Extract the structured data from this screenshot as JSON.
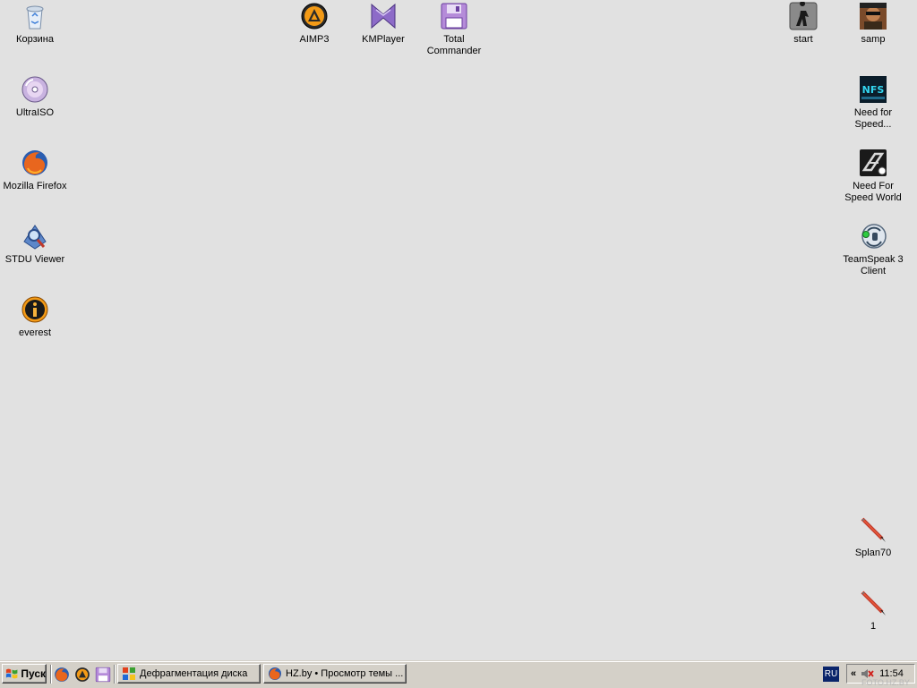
{
  "desktop": {
    "icons": {
      "recycle_bin": "Корзина",
      "ultraiso": "UltraISO",
      "firefox": "Mozilla Firefox",
      "stdu": "STDU Viewer",
      "everest": "everest",
      "aimp": "AIMP3",
      "kmplayer": "KMPlayer",
      "total_commander": "Total Commander",
      "start": "start",
      "samp": "samp",
      "nfs": "Need for Speed...",
      "nfs_world": "Need For Speed World",
      "teamspeak": "TeamSpeak 3 Client",
      "splan": "Splan70",
      "one": "1"
    }
  },
  "taskbar": {
    "start_label": "Пуск",
    "tasks": [
      "Дефрагментация диска",
      "HZ.by • Просмотр темы ..."
    ],
    "language": "RU",
    "tray_chevron": "«",
    "clock": "11:54"
  },
  "watermark": "FOTO.HZ.BY"
}
